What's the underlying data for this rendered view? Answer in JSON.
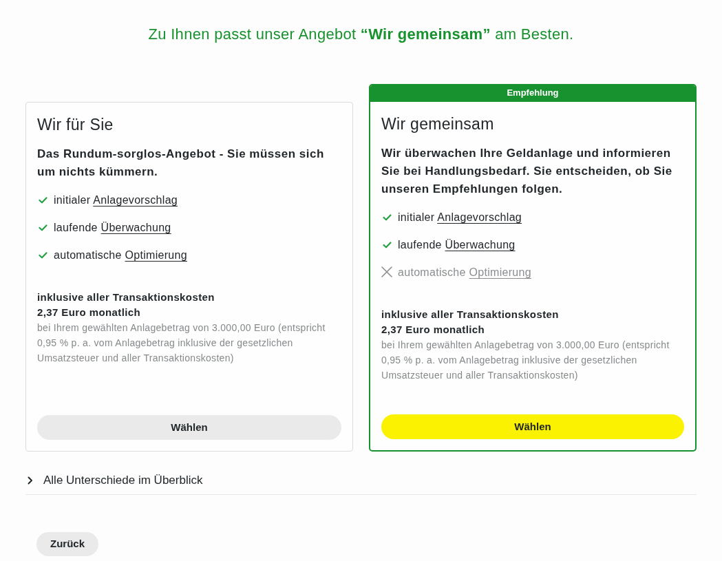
{
  "heading": "Zu Ihnen passt unser Angebot **“Wir gemeinsam”** am Besten.",
  "plans": [
    {
      "recommended": false,
      "title": "Wir für Sie",
      "description": "Das Rundum-sorglos-Angebot - Sie müssen sich um nichts kümmern.",
      "features": [
        {
          "text": "initialer",
          "link": "Anlagevorschlag",
          "included": true
        },
        {
          "text": "laufende",
          "link": "Überwachung",
          "included": true
        },
        {
          "text": "automatische",
          "link": "Optimierung",
          "included": true
        }
      ],
      "cost_label": "inklusive aller Transaktionskosten",
      "price": "2,37 Euro monatlich",
      "price_note": "bei Ihrem gewählten Anlagebetrag von 3.000,00 Euro (entspricht 0,95 % p. a. vom Anlagebetrag inklusive der gesetzlichen Umsatzsteuer und aller Transaktionskosten)",
      "button": "Wählen"
    },
    {
      "recommended": true,
      "badge": "Empfehlung",
      "title": "Wir gemeinsam",
      "description": "Wir überwachen Ihre Geldanlage und informieren Sie bei Handlungsbedarf. Sie entscheiden, ob Sie unseren Empfehlungen folgen.",
      "features": [
        {
          "text": "initialer",
          "link": "Anlagevorschlag",
          "included": true
        },
        {
          "text": "laufende",
          "link": "Überwachung",
          "included": true
        },
        {
          "text": "automatische",
          "link": "Optimierung",
          "included": false
        }
      ],
      "cost_label": "inklusive aller Transaktionskosten",
      "price": "2,37 Euro monatlich",
      "price_note": "bei Ihrem gewählten Anlagebetrag von 3.000,00 Euro (entspricht 0,95 % p. a. vom Anlagebetrag inklusive der gesetzlichen Umsatzsteuer und aller Transaktionskosten)",
      "button": "Wählen"
    }
  ],
  "details_toggle": {
    "label": "Alle Unterschiede im Überblick",
    "expanded": false
  },
  "back_button": "Zurück"
}
